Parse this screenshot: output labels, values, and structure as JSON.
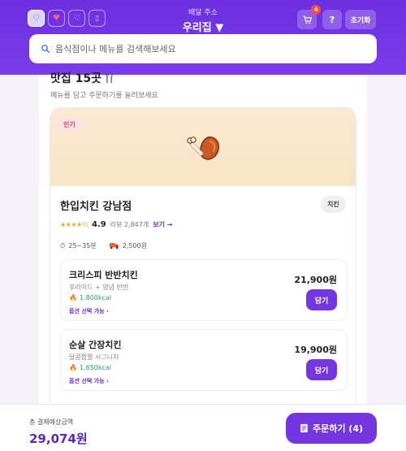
{
  "header": {
    "address_label": "배달 주소",
    "address_value": "우리집 ▼",
    "cart_count": "4",
    "help_label": "?",
    "reset_label": "초기화",
    "chips": [
      "heart-icon",
      "heart-icon",
      "heart-icon",
      "square-icon"
    ]
  },
  "search": {
    "placeholder": "음식점이나 메뉴를 검색해보세요"
  },
  "section": {
    "title": "맛집 15곳",
    "subtitle": "메뉴를 담고 주문하기를 눌러보세요"
  },
  "store": {
    "badge": "인기",
    "name": "한입치킨 강남점",
    "category": "치킨",
    "stars": "★★★★½",
    "rating": "4.9",
    "reviews": "리뷰 2,847개",
    "review_link": "보기 →",
    "time": "25~35분",
    "fee": "2,500원",
    "hero_icon": "chicken-leg-icon"
  },
  "menu_items": [
    {
      "name": "크리스피 반반치킨",
      "desc": "후라이드 + 양념 반반",
      "kcal": "1,800kcal",
      "option": "옵션 선택 가능 ›",
      "price": "21,900원",
      "button": "담기"
    },
    {
      "name": "순살 간장치킨",
      "desc": "달콤짭짤 시그니처",
      "kcal": "1,650kcal",
      "option": "옵션 선택 가능 ›",
      "price": "19,900원",
      "button": "담기"
    }
  ],
  "footer": {
    "total_label": "총 결제예상금액",
    "total_value": "29,074원",
    "order_label": "주문하기 (4)"
  },
  "colors": {
    "accent": "#7336e0",
    "header": "#6c2fe0",
    "kcal": "#2aa06a",
    "badge": "#ff4b3e"
  }
}
